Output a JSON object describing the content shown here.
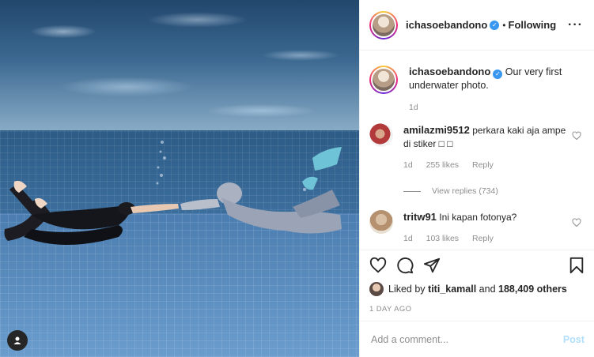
{
  "post": {
    "author": "ichasoebandono",
    "follow_status": "Following",
    "more_icon": "more-horizontal-icon"
  },
  "caption": {
    "author": "ichasoebandono",
    "text": "Our very first underwater photo.",
    "age": "1d"
  },
  "comments": [
    {
      "author": "amilazmi9512",
      "text": "perkara kaki aja ampe di stiker □ □",
      "age": "1d",
      "likes": "255 likes",
      "reply": "Reply",
      "view_replies": "View replies (734)"
    },
    {
      "author": "tritw91",
      "text": "Ini kapan fotonya?",
      "age": "1d",
      "likes": "103 likes",
      "reply": "Reply"
    }
  ],
  "actions": {
    "like_icon": "heart-icon",
    "comment_icon": "comment-icon",
    "share_icon": "send-icon",
    "save_icon": "bookmark-icon"
  },
  "likes": {
    "prefix": "Liked by",
    "user": "titi_kamall",
    "middle": "and",
    "others": "188,409 others"
  },
  "timestamp": "1 DAY AGO",
  "add_comment": {
    "placeholder": "Add a comment...",
    "post_label": "Post"
  },
  "colors": {
    "verified": "#3897f0",
    "post_disabled": "#b2dffc",
    "muted": "#8e8e8e"
  }
}
